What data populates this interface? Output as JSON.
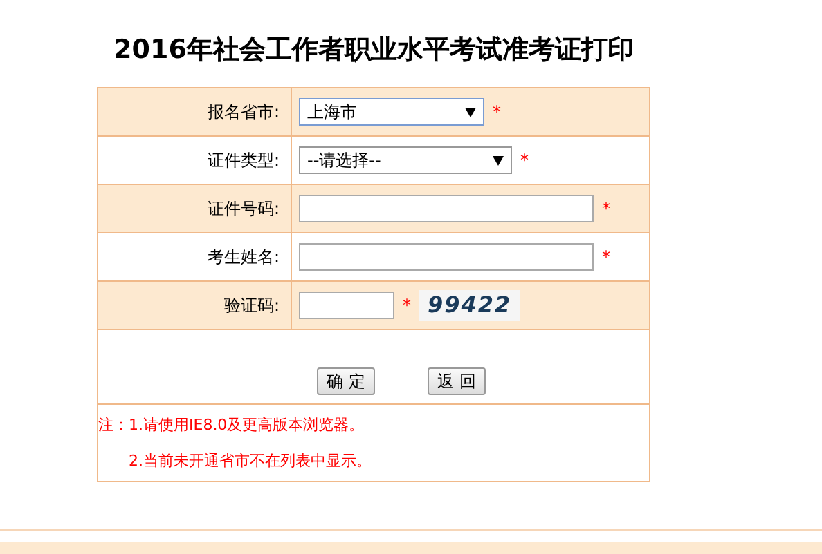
{
  "title": "2016年社会工作者职业水平考试准考证打印",
  "fields": [
    {
      "kind": "select",
      "label": "报名省市:",
      "value": "上海市",
      "focused": true,
      "mark": "*"
    },
    {
      "kind": "select",
      "label": "证件类型:",
      "value": "--请选择--",
      "focused": false,
      "mark": "*"
    },
    {
      "kind": "text",
      "label": "证件号码:",
      "focused": false,
      "mark": "*"
    },
    {
      "kind": "text",
      "label": "考生姓名:",
      "focused": false,
      "mark": "*"
    },
    {
      "kind": "captcha",
      "label": "验证码:",
      "captcha": "99422",
      "focused": false,
      "mark": "*"
    }
  ],
  "buttons": [
    "确 定",
    "返 回"
  ],
  "notes": [
    "注：1.请使用IE8.0及更高版本浏览器。",
    "2.当前未开通省市不在列表中显示。"
  ]
}
